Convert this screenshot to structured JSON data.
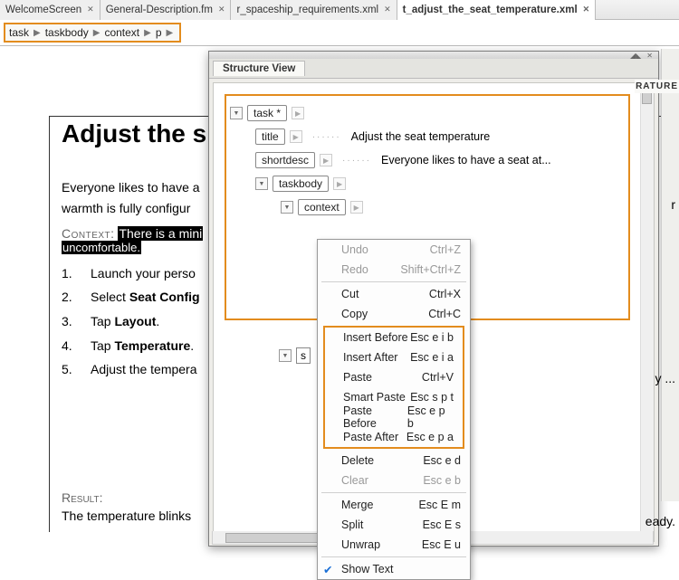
{
  "tabs": [
    {
      "label": "WelcomeScreen",
      "active": false
    },
    {
      "label": "General-Description.fm",
      "active": false
    },
    {
      "label": "r_spaceship_requirements.xml",
      "active": false
    },
    {
      "label": "t_adjust_the_seat_temperature.xml",
      "active": true
    }
  ],
  "breadcrumb": [
    "task",
    "taskbody",
    "context",
    "p"
  ],
  "doc": {
    "title": "Adjust the s",
    "intro1": "Everyone likes to have a",
    "intro2": "warmth is fully configur",
    "ctx_label": "Context:",
    "ctx_hl1": "There is a mini",
    "ctx_hl2": "uncomfortable.",
    "steps": [
      {
        "n": "1.",
        "t": "Launch your perso"
      },
      {
        "n": "2.",
        "t_pre": "Select ",
        "t_bold": "Seat Config"
      },
      {
        "n": "3.",
        "t_pre": "Tap ",
        "t_bold": "Layout",
        "t_post": "."
      },
      {
        "n": "4.",
        "t_pre": "Tap ",
        "t_bold": "Temperature",
        "t_post": "."
      },
      {
        "n": "5.",
        "t": "Adjust the tempera"
      }
    ],
    "res_label": "Result:",
    "res_line": "The temperature blinks"
  },
  "panel": {
    "title": "Structure View",
    "tree": {
      "task": "task *",
      "title": "title",
      "title_text": "Adjust the seat temperature",
      "shortdesc": "shortdesc",
      "shortdesc_text": "Everyone likes to have a seat at...",
      "taskbody": "taskbody",
      "context": "context",
      "s": "s"
    },
    "edge_text": "RATURE",
    "truncated_r": "r",
    "truncated_y": "y ...",
    "truncated_ready": "eady."
  },
  "menu": {
    "undo": {
      "l": "Undo",
      "k": "Ctrl+Z"
    },
    "redo": {
      "l": "Redo",
      "k": "Shift+Ctrl+Z"
    },
    "cut": {
      "l": "Cut",
      "k": "Ctrl+X"
    },
    "copy": {
      "l": "Copy",
      "k": "Ctrl+C"
    },
    "ib": {
      "l": "Insert Before",
      "k": "Esc e i b"
    },
    "ia": {
      "l": "Insert After",
      "k": "Esc e i a"
    },
    "paste": {
      "l": "Paste",
      "k": "Ctrl+V"
    },
    "sp": {
      "l": "Smart Paste",
      "k": "Esc s p t"
    },
    "pb": {
      "l": "Paste Before",
      "k": "Esc e p b"
    },
    "pa": {
      "l": "Paste After",
      "k": "Esc e p a"
    },
    "del": {
      "l": "Delete",
      "k": "Esc e d"
    },
    "clr": {
      "l": "Clear",
      "k": "Esc e b"
    },
    "merge": {
      "l": "Merge",
      "k": "Esc E m"
    },
    "split": {
      "l": "Split",
      "k": "Esc E s"
    },
    "unwrap": {
      "l": "Unwrap",
      "k": "Esc E u"
    },
    "show": {
      "l": "Show Text",
      "k": ""
    }
  }
}
